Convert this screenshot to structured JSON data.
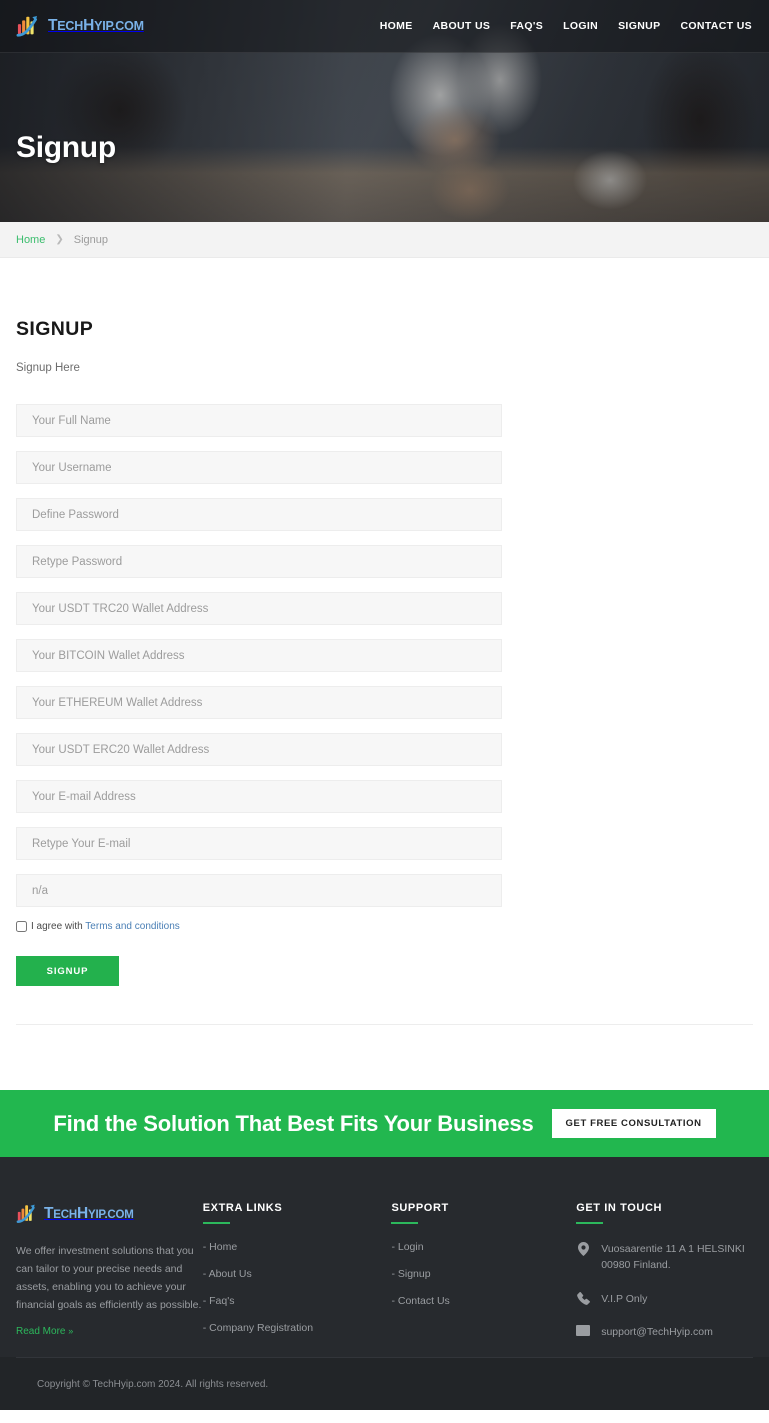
{
  "brand": {
    "name_cap_1": "T",
    "name_rest_1": "ECH",
    "name_cap_2": "H",
    "name_rest_2": "YIP",
    "name_suffix": ".COM",
    "full": "TechHyip.com",
    "logo_icon": "bar-chart-arrow-logo-icon",
    "accent_green": "#2cb85c",
    "accent_blue": "#7ab2e8"
  },
  "header": {
    "nav": [
      {
        "label": "HOME",
        "name": "nav-home"
      },
      {
        "label": "ABOUT US",
        "name": "nav-about-us"
      },
      {
        "label": "FAQ'S",
        "name": "nav-faqs"
      },
      {
        "label": "LOGIN",
        "name": "nav-login"
      },
      {
        "label": "SIGNUP",
        "name": "nav-signup"
      },
      {
        "label": "CONTACT US",
        "name": "nav-contact-us"
      }
    ]
  },
  "hero": {
    "title": "Signup"
  },
  "breadcrumb": {
    "home": "Home",
    "separator": "❯",
    "current": "Signup"
  },
  "signup": {
    "title": "SIGNUP",
    "subtitle": "Signup Here",
    "fields": [
      {
        "name": "full-name-input",
        "placeholder": "Your Full Name",
        "value": "",
        "type": "text"
      },
      {
        "name": "username-input",
        "placeholder": "Your Username",
        "value": "",
        "type": "text"
      },
      {
        "name": "password-input",
        "placeholder": "Define Password",
        "value": "",
        "type": "password"
      },
      {
        "name": "retype-password-input",
        "placeholder": "Retype Password",
        "value": "",
        "type": "password"
      },
      {
        "name": "usdt-trc20-wallet-input",
        "placeholder": "Your USDT TRC20 Wallet Address",
        "value": "",
        "type": "text"
      },
      {
        "name": "bitcoin-wallet-input",
        "placeholder": "Your BITCOIN Wallet Address",
        "value": "",
        "type": "text"
      },
      {
        "name": "ethereum-wallet-input",
        "placeholder": "Your ETHEREUM Wallet Address",
        "value": "",
        "type": "text"
      },
      {
        "name": "usdt-erc20-wallet-input",
        "placeholder": "Your USDT ERC20 Wallet Address",
        "value": "",
        "type": "text"
      },
      {
        "name": "email-input",
        "placeholder": "Your E-mail Address",
        "value": "",
        "type": "text"
      },
      {
        "name": "retype-email-input",
        "placeholder": "Retype Your E-mail",
        "value": "",
        "type": "text"
      },
      {
        "name": "referral-input",
        "placeholder": "n/a",
        "value": "",
        "type": "text"
      }
    ],
    "agree_prefix": "I agree with ",
    "terms_link": "Terms and conditions",
    "submit_label": "SIGNUP",
    "checkbox_checked": false
  },
  "cta": {
    "heading": "Find the Solution That Best Fits Your Business",
    "button": "GET FREE CONSULTATION",
    "bg": "#22b74f"
  },
  "footer": {
    "about_text": "We offer investment solutions that you can tailor to your precise needs and assets, enabling you to achieve your financial goals as efficiently as possible.",
    "read_more": "Read More",
    "read_more_chevron": "»",
    "extra_links": {
      "title": "EXTRA LINKS",
      "items": [
        {
          "label": "- Home",
          "name": "footer-link-home"
        },
        {
          "label": "- About Us",
          "name": "footer-link-about-us"
        },
        {
          "label": "- Faq's",
          "name": "footer-link-faqs"
        },
        {
          "label": "- Company Registration",
          "name": "footer-link-company-registration"
        }
      ]
    },
    "support": {
      "title": "SUPPORT",
      "items": [
        {
          "label": "- Login",
          "name": "footer-link-login"
        },
        {
          "label": "- Signup",
          "name": "footer-link-signup"
        },
        {
          "label": "- Contact Us",
          "name": "footer-link-contact-us"
        }
      ]
    },
    "get_in_touch": {
      "title": "GET IN TOUCH",
      "address": "Vuosaarentie 11 A 1 HELSINKI 00980 Finland.",
      "phone": "V.I.P Only",
      "email": "support@TechHyip.com",
      "address_icon": "location-pin-icon",
      "phone_icon": "phone-icon",
      "email_icon": "envelope-icon"
    }
  },
  "copyright": {
    "text": "Copyright © TechHyip.com 2024. All rights reserved."
  }
}
